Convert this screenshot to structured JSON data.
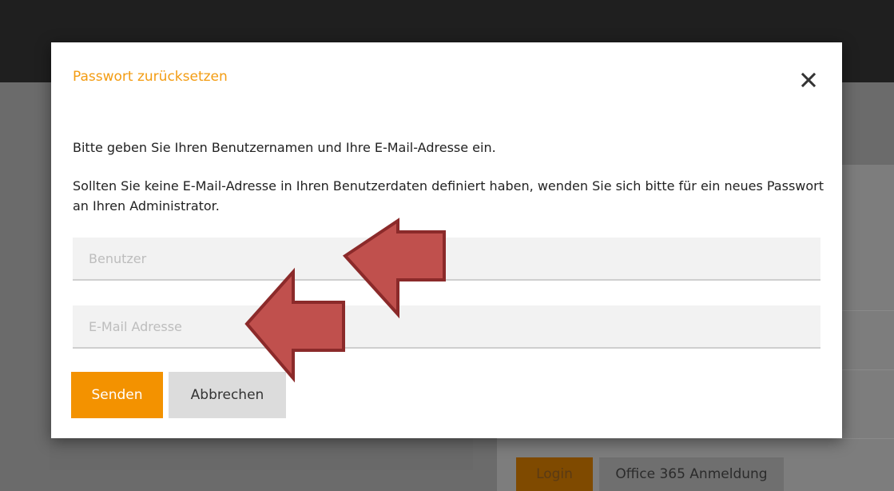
{
  "background": {
    "login_label": "Login",
    "office365_label": "Office 365 Anmeldung"
  },
  "modal": {
    "title": "Passwort zurücksetzen",
    "close_icon": "close-icon",
    "instruction_1": "Bitte geben Sie Ihren Benutzernamen und Ihre E-Mail-Adresse ein.",
    "instruction_2": "Sollten Sie keine E-Mail-Adresse in Ihren Benutzerdaten definiert haben, wenden Sie sich bitte für ein neues Passwort an Ihren Administrator.",
    "username_field": {
      "value": "",
      "placeholder": "Benutzer"
    },
    "email_field": {
      "value": "",
      "placeholder": "E-Mail Adresse"
    },
    "send_label": "Senden",
    "cancel_label": "Abbrechen"
  },
  "colors": {
    "accent": "#f39200",
    "title": "#f39c12",
    "arrow_fill": "#c0504d",
    "arrow_stroke": "#8b2a2a"
  }
}
